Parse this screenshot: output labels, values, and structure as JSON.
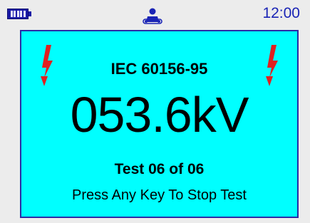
{
  "status": {
    "battery_icon": "battery-full-icon",
    "center_icon": "operator-icon",
    "time": "12:00"
  },
  "colors": {
    "screen_bg": "#00ffff",
    "screen_border": "#2a2aa5",
    "bolt": "#e02020",
    "accent": "#1a24b5"
  },
  "screen": {
    "warning_icon": "high-voltage-icon",
    "standard": "IEC 60156-95",
    "reading": "053.6kV",
    "test_status": "Test 06 of 06",
    "prompt": "Press Any Key To Stop Test"
  }
}
